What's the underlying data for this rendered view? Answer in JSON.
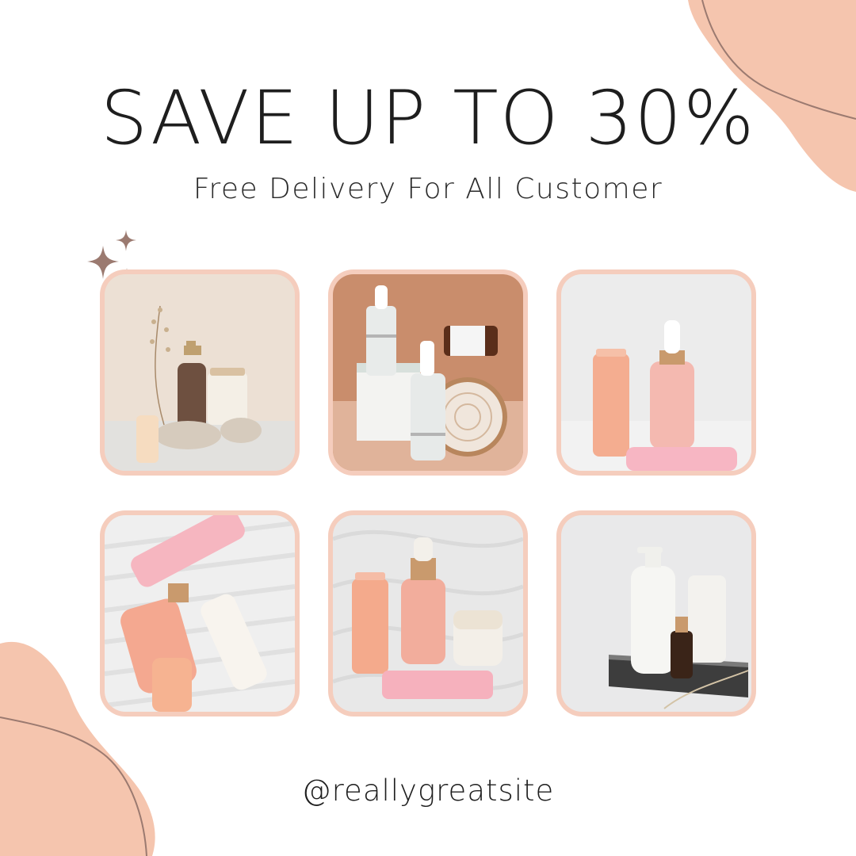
{
  "headline": "SAVE UP TO 30%",
  "subheadline": "Free Delivery For All Customer",
  "handle": "@reallygreatsite",
  "colors": {
    "accent_peach": "#f5c5ae",
    "frame": "#f5cdbd",
    "line_brown": "#9b7a70",
    "sparkle": "#9b7a70",
    "text": "#1e1e1e"
  },
  "decorations": [
    "sparkle-icon",
    "sparkle-icon",
    "sparkle-icon"
  ],
  "products": [
    {
      "scene": "amber-spray-bottle-candle-stones-dried-flowers"
    },
    {
      "scene": "white-dropper-bottles-wood-slice-box"
    },
    {
      "scene": "pink-serum-dropper-peach-tube"
    },
    {
      "scene": "pink-tubes-serum-bottle-white-fabric"
    },
    {
      "scene": "peach-tube-serum-jar-pink-tube"
    },
    {
      "scene": "white-pump-bottle-tube-amber-dropper"
    }
  ]
}
